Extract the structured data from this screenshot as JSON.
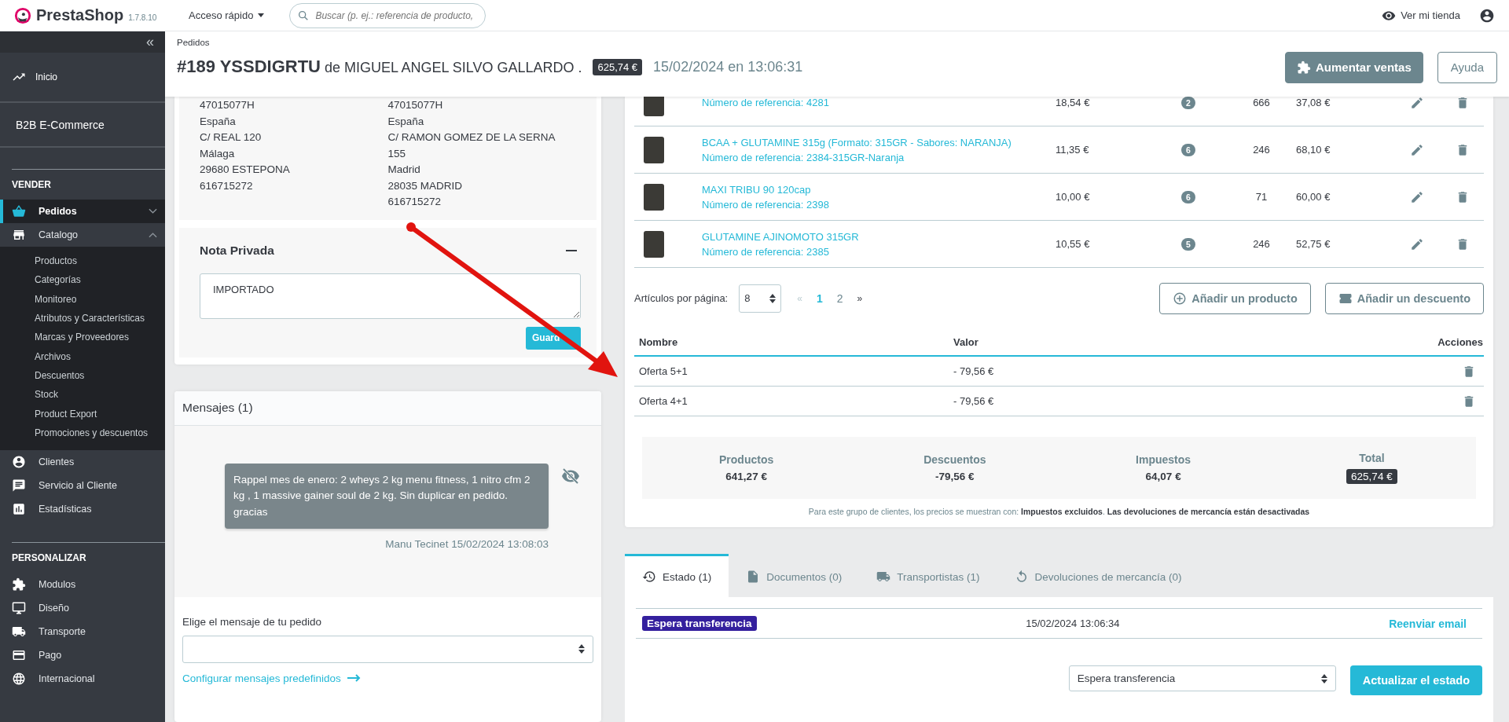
{
  "topbar": {
    "brand": "PrestaShop",
    "version": "1.7.8.10",
    "quick_access": "Acceso rápido",
    "search": {
      "placeholder": "Buscar (p. ej.: referencia de producto,"
    },
    "view_store": "Ver mi tienda"
  },
  "sidebar": {
    "collapse": "«",
    "home": "Inicio",
    "shop": "B2B E-Commerce",
    "sections": [
      {
        "title": "VENDER",
        "items": [
          {
            "label": "Pedidos",
            "kind": "group",
            "selected": true,
            "expanded": false
          },
          {
            "label": "Catalogo",
            "kind": "group",
            "selected": false,
            "expanded": true,
            "children": [
              {
                "label": "Productos",
                "selected": false
              },
              {
                "label": "Categorías",
                "selected": false
              },
              {
                "label": "Monitoreo",
                "selected": false
              },
              {
                "label": "Atributos y Características",
                "selected": false
              },
              {
                "label": "Marcas y Proveedores",
                "selected": false
              },
              {
                "label": "Archivos",
                "selected": false
              },
              {
                "label": "Descuentos",
                "selected": false
              },
              {
                "label": "Stock",
                "selected": false
              },
              {
                "label": "Product Export",
                "selected": false
              },
              {
                "label": "Promociones y descuentos",
                "selected": false
              }
            ]
          },
          {
            "label": "Clientes",
            "kind": "link",
            "selected": false
          },
          {
            "label": "Servicio al Cliente",
            "kind": "link",
            "selected": false
          },
          {
            "label": "Estadísticas",
            "kind": "link",
            "selected": false
          }
        ]
      },
      {
        "title": "PERSONALIZAR",
        "items": [
          {
            "label": "Modulos",
            "kind": "link",
            "selected": false
          },
          {
            "label": "Diseño",
            "kind": "link",
            "selected": false
          },
          {
            "label": "Transporte",
            "kind": "link",
            "selected": false
          },
          {
            "label": "Pago",
            "kind": "link",
            "selected": false
          },
          {
            "label": "Internacional",
            "kind": "link",
            "selected": false
          }
        ]
      }
    ]
  },
  "header": {
    "breadcrumb": "Pedidos",
    "title": "**#189 YSSDIGRTU** de MIGUEL ANGEL SILVO GALLARDO .",
    "total": "625,74 €",
    "date": "15/02/2024 en 13:06:31",
    "buttons": [
      {
        "label": "Aumentar ventas",
        "kind": "primary"
      },
      {
        "label": "Ayuda",
        "kind": "secondary"
      }
    ]
  },
  "addresses": [
    [
      "47015077H",
      "España",
      "C/ REAL 120",
      "Málaga",
      "29680 ESTEPONA",
      "616715272"
    ],
    [
      "47015077H",
      "España",
      "C/ RAMON GOMEZ DE LA SERNA",
      "155",
      "Madrid",
      "28035 MADRID",
      "616715272"
    ]
  ],
  "private_note": {
    "title": "Nota Privada",
    "value": "IMPORTADO",
    "button": "Guard"
  },
  "messages": {
    "title": "Mensajes (1)",
    "items": [
      {
        "text": "Rappel mes de enero: 2 wheys 2 kg menu fitness, 1 nitro cfm 2 kg , 1 massive gainer soul de 2 kg. Sin duplicar en pedido. gracias",
        "author": "Manu Tecinet 15/02/2024 13:08:03"
      }
    ],
    "form_label": "Elige el mensaje de tu pedido",
    "configure_link": "Configurar mensajes predefinidos"
  },
  "products": {
    "rows": [
      {
        "reference": "Número de referencia: 4281",
        "price": "18,54 €",
        "quantity": "2",
        "stock": "666",
        "total": "37,08 €"
      },
      {
        "name": "BCAA + GLUTAMINE 315g (Formato: 315GR - Sabores: NARANJA)",
        "reference": "Número de referencia: 2384-315GR-Naranja",
        "price": "11,35 €",
        "quantity": "6",
        "stock": "246",
        "total": "68,10 €"
      },
      {
        "name": "MAXI TRIBU 90 120cap",
        "reference": "Número de referencia: 2398",
        "price": "10,00 €",
        "quantity": "6",
        "stock": "71",
        "total": "60,00 €"
      },
      {
        "name": "GLUTAMINE AJINOMOTO 315GR",
        "reference": "Número de referencia: 2385",
        "price": "10,55 €",
        "quantity": "5",
        "stock": "246",
        "total": "52,75 €"
      }
    ],
    "per_page_label": "Artículos por página:",
    "per_page": "8",
    "prev": "«",
    "next": "»",
    "pages": [
      {
        "label": "1",
        "selected": true
      },
      {
        "label": "2",
        "selected": false
      }
    ],
    "actions": [
      "Añadir un producto",
      "Añadir un descuento"
    ]
  },
  "discounts": {
    "columns": [
      "Nombre",
      "Valor",
      "Acciones"
    ],
    "rows": [
      {
        "name": "Oferta 5+1",
        "value": "- 79,56 €"
      },
      {
        "name": "Oferta 4+1",
        "value": "- 79,56 €"
      }
    ]
  },
  "summary": [
    {
      "label": "Productos",
      "value": "641,27 €",
      "kind": "plain"
    },
    {
      "label": "Descuentos",
      "value": "-79,56 €",
      "kind": "plain"
    },
    {
      "label": "Impuestos",
      "value": "64,07 €",
      "kind": "plain"
    },
    {
      "label": "Total",
      "value": "625,74 €",
      "kind": "badge"
    }
  ],
  "price_note": "Para este grupo de clientes, los precios se muestran con: **Impuestos excluidos**. **Las devoluciones de mercancía están desactivadas**",
  "tabs": [
    {
      "label": "Estado (1)",
      "selected": true
    },
    {
      "label": "Documentos (0)",
      "selected": false
    },
    {
      "label": "Transportistas (1)",
      "selected": false
    },
    {
      "label": "Devoluciones de mercancía (0)",
      "selected": false
    }
  ],
  "history": [
    {
      "status": "Espera transferencia",
      "color": "#34209e",
      "date": "15/02/2024 13:06:34",
      "action": "Reenviar email"
    }
  ],
  "status_form": {
    "value": "Espera transferencia",
    "button": "Actualizar el estado"
  }
}
